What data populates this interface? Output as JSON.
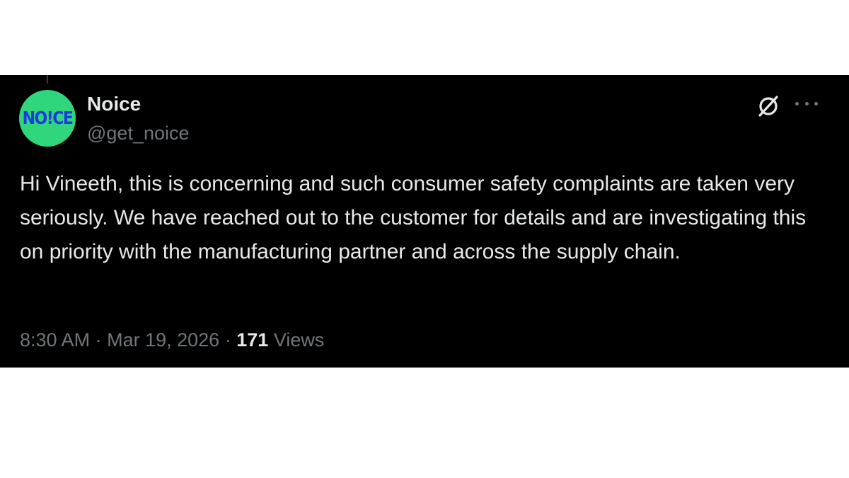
{
  "tweet": {
    "author": {
      "display_name": "Noice",
      "handle": "@get_noice",
      "avatar_logo_text": "NO!CE",
      "avatar_bg_color": "#2fd67c",
      "avatar_logo_color": "#1d3ce0"
    },
    "text": "Hi Vineeth, this is concerning and such consumer safety complaints are taken very seriously. We have reached out to the customer for details and are investigating this on priority with the manufacturing partner and across the supply chain.",
    "meta": {
      "time": "8:30 AM",
      "separator": "·",
      "date": "Mar 19, 2026",
      "views_count": "171",
      "views_label": "Views"
    },
    "icons": {
      "grok": "grok-icon",
      "more": "more-options-icon"
    }
  },
  "colors": {
    "background": "#000000",
    "text_primary": "#e7e9ea",
    "text_secondary": "#71767b"
  }
}
